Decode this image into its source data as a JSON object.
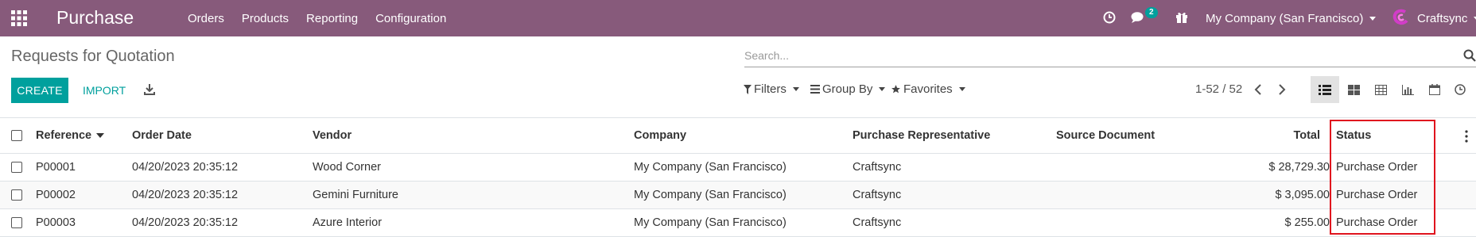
{
  "navbar": {
    "app_title": "Purchase",
    "menu": [
      "Orders",
      "Products",
      "Reporting",
      "Configuration"
    ],
    "chat_count": "2",
    "company": "My Company (San Francisco)",
    "user": "Craftsync",
    "icons": [
      "apps-icon",
      "clock-icon",
      "chat-icon",
      "gift-icon",
      "avatar"
    ]
  },
  "control": {
    "page_title": "Requests for Quotation",
    "search_placeholder": "Search...",
    "create_label": "CREATE",
    "import_label": "IMPORT",
    "filters_label": "Filters",
    "groupby_label": "Group By",
    "favorites_label": "Favorites",
    "pager": "1-52 / 52",
    "views": [
      "list-view-icon",
      "kanban-view-icon",
      "pivot-view-icon",
      "graph-view-icon",
      "calendar-view-icon",
      "activity-view-icon"
    ],
    "active_view": "list-view-icon"
  },
  "table": {
    "headers": {
      "reference": "Reference",
      "order_date": "Order Date",
      "vendor": "Vendor",
      "company": "Company",
      "rep": "Purchase Representative",
      "source": "Source Document",
      "total": "Total",
      "status": "Status"
    },
    "rows": [
      {
        "reference": "P00001",
        "order_date": "04/20/2023 20:35:12",
        "vendor": "Wood Corner",
        "company": "My Company (San Francisco)",
        "rep": "Craftsync",
        "source": "",
        "total": "$ 28,729.30",
        "status": "Purchase Order"
      },
      {
        "reference": "P00002",
        "order_date": "04/20/2023 20:35:12",
        "vendor": "Gemini Furniture",
        "company": "My Company (San Francisco)",
        "rep": "Craftsync",
        "source": "",
        "total": "$ 3,095.00",
        "status": "Purchase Order"
      },
      {
        "reference": "P00003",
        "order_date": "04/20/2023 20:35:12",
        "vendor": "Azure Interior",
        "company": "My Company (San Francisco)",
        "rep": "Craftsync",
        "source": "",
        "total": "$ 255.00",
        "status": "Purchase Order"
      }
    ]
  },
  "colors": {
    "navbar": "#875a7b",
    "primary": "#00a09d",
    "highlight": "#e0141e"
  }
}
